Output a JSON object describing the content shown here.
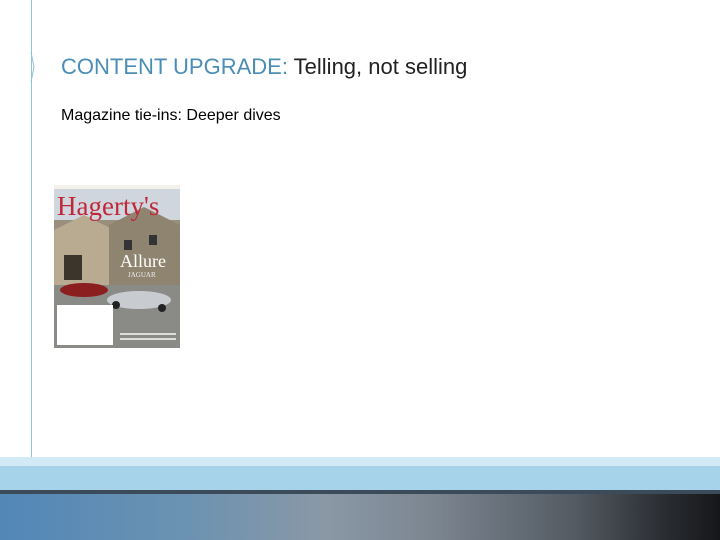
{
  "slide": {
    "title_highlight": "CONTENT UPGRADE:",
    "title_rest": " Telling, not selling",
    "subtitle": "Magazine tie-ins: Deeper dives"
  },
  "magazine": {
    "masthead": "Hagerty's",
    "headline": "Allure",
    "subhead": "JAGUAR"
  },
  "colors": {
    "accent": "#4a8db5",
    "band": "#a6d3ea"
  }
}
